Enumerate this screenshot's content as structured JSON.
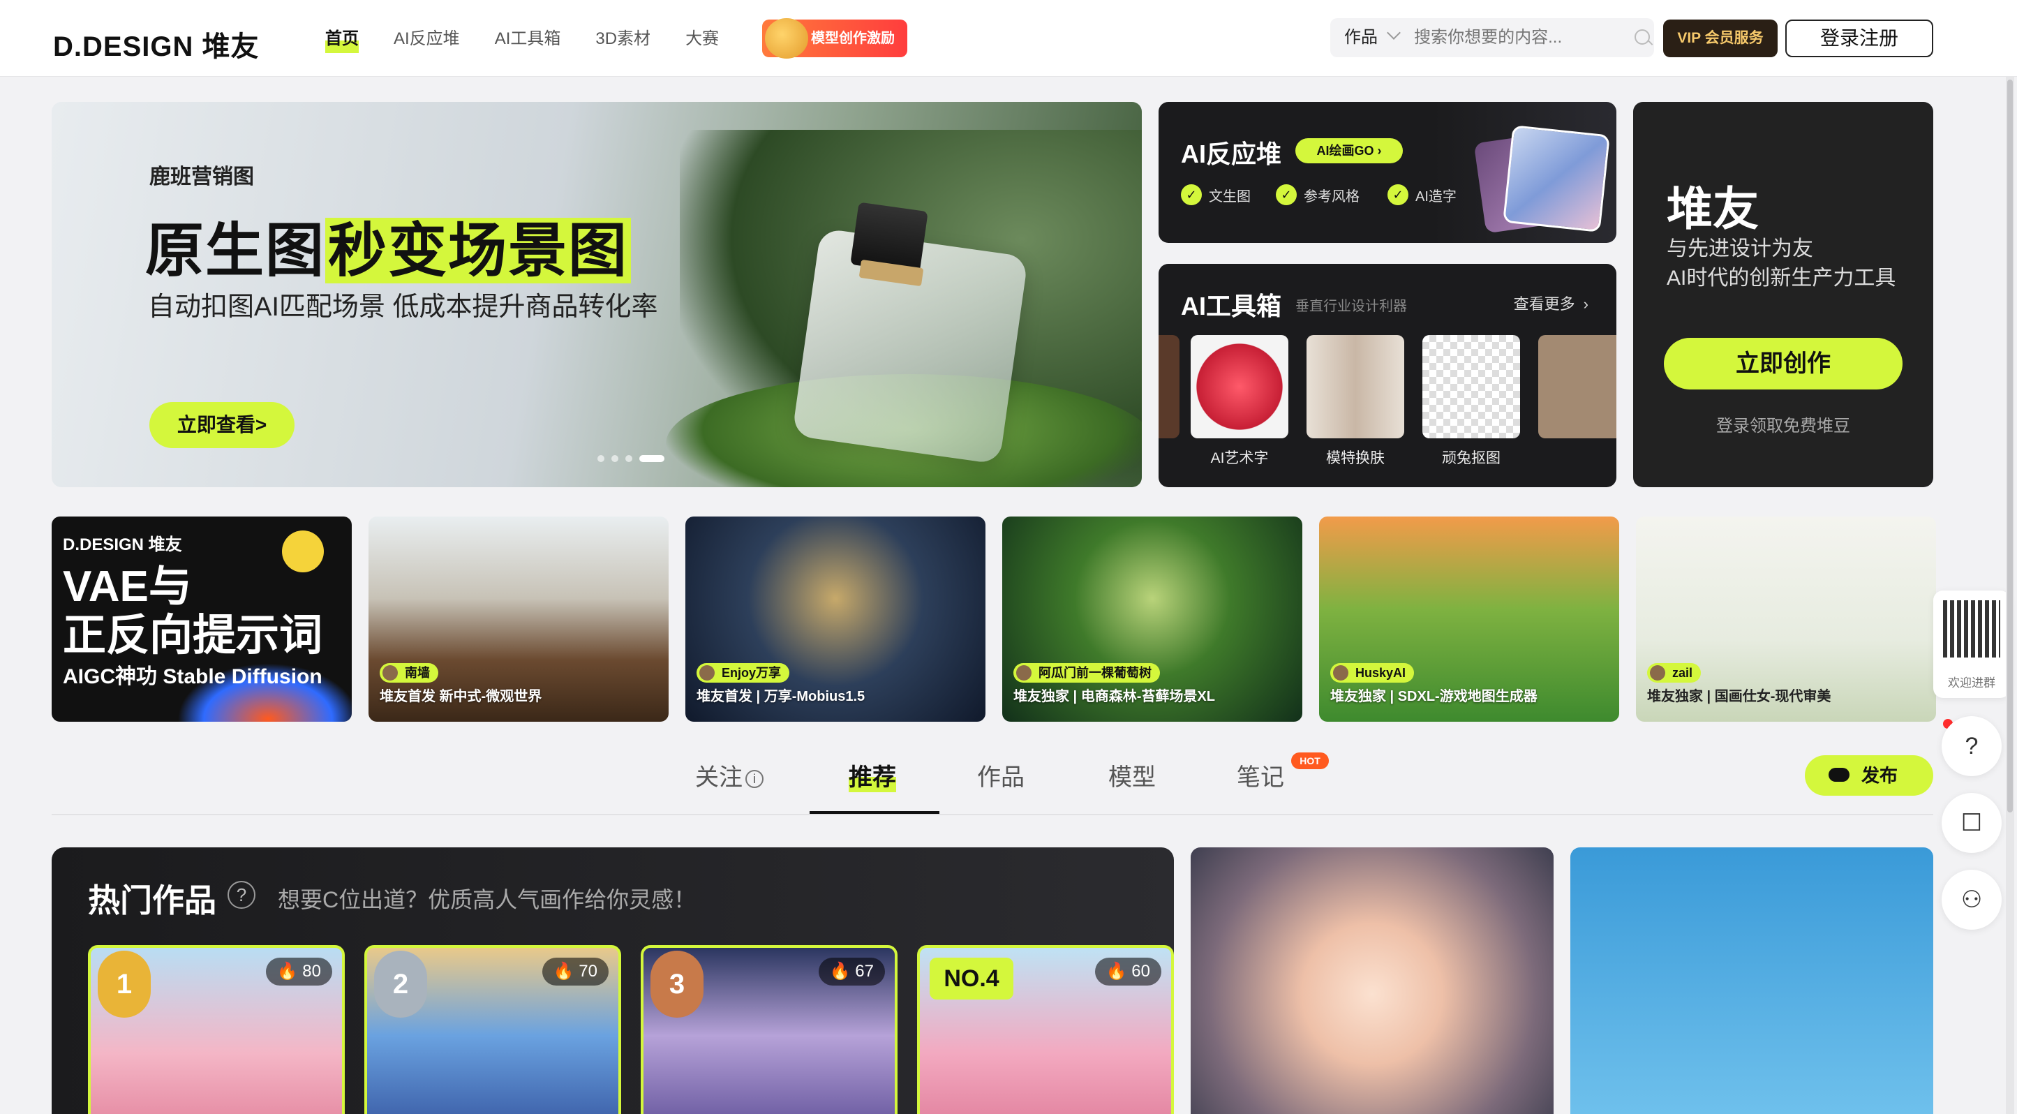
{
  "header": {
    "logo": "D.DESIGN 堆友",
    "nav": [
      "首页",
      "AI反应堆",
      "AI工具箱",
      "3D素材",
      "大赛"
    ],
    "promo": "模型创作激励",
    "search_scope": "作品",
    "search_placeholder": "搜索你想要的内容...",
    "vip": "VIP 会员服务",
    "login": "登录注册"
  },
  "banner": {
    "subtitle": "鹿班营销图",
    "title_plain": "原生图",
    "title_highlight": "秒变场景图",
    "desc": "自动扣图AI匹配场景 低成本提升商品转化率",
    "button": "立即查看>"
  },
  "aigc": {
    "title": "AI反应堆",
    "go": "AI绘画GO ›",
    "features": [
      "文生图",
      "参考风格",
      "AI造字"
    ]
  },
  "toolbox": {
    "title": "AI工具箱",
    "subtitle": "垂直行业设计利器",
    "more": "查看更多",
    "items": [
      "AI艺术字",
      "模特换肤",
      "顽兔抠图"
    ]
  },
  "promo_card": {
    "title": "堆友",
    "line1": "与先进设计为友",
    "line2": "AI时代的创新生产力工具",
    "button": "立即创作",
    "note": "登录领取免费堆豆"
  },
  "thumbs": {
    "first": {
      "brand": "D.DESIGN 堆友",
      "headline1": "VAE与",
      "headline2": "正反向提示词",
      "footer": "AIGC神功 Stable Diffusion"
    },
    "items": [
      {
        "author": "南墙",
        "caption": "堆友首发  新中式-微观世界"
      },
      {
        "author": "Enjoy万享",
        "caption": "堆友首发 | 万享-Mobius1.5"
      },
      {
        "author": "阿瓜门前一棵葡萄树",
        "caption": "堆友独家 | 电商森林-苔藓场景XL"
      },
      {
        "author": "HuskyAI",
        "caption": "堆友独家 | SDXL-游戏地图生成器"
      },
      {
        "author": "zail",
        "caption": "堆友独家 | 国画仕女-现代审美"
      }
    ]
  },
  "tabs": {
    "items": [
      "关注",
      "推荐",
      "作品",
      "模型",
      "笔记"
    ],
    "hot": "HOT",
    "publish": "发布"
  },
  "hot_works": {
    "title": "热门作品",
    "subtitle": "想要C位出道？优质高人气画作给你灵感！",
    "cards": [
      {
        "rank": "1",
        "count": "80"
      },
      {
        "rank": "2",
        "count": "70"
      },
      {
        "rank": "3",
        "count": "67"
      },
      {
        "rank": "NO.4",
        "count": "60"
      }
    ]
  },
  "side": {
    "qr_label": "欢迎进群",
    "help": "?",
    "chat": "☐",
    "users": "⚇"
  }
}
